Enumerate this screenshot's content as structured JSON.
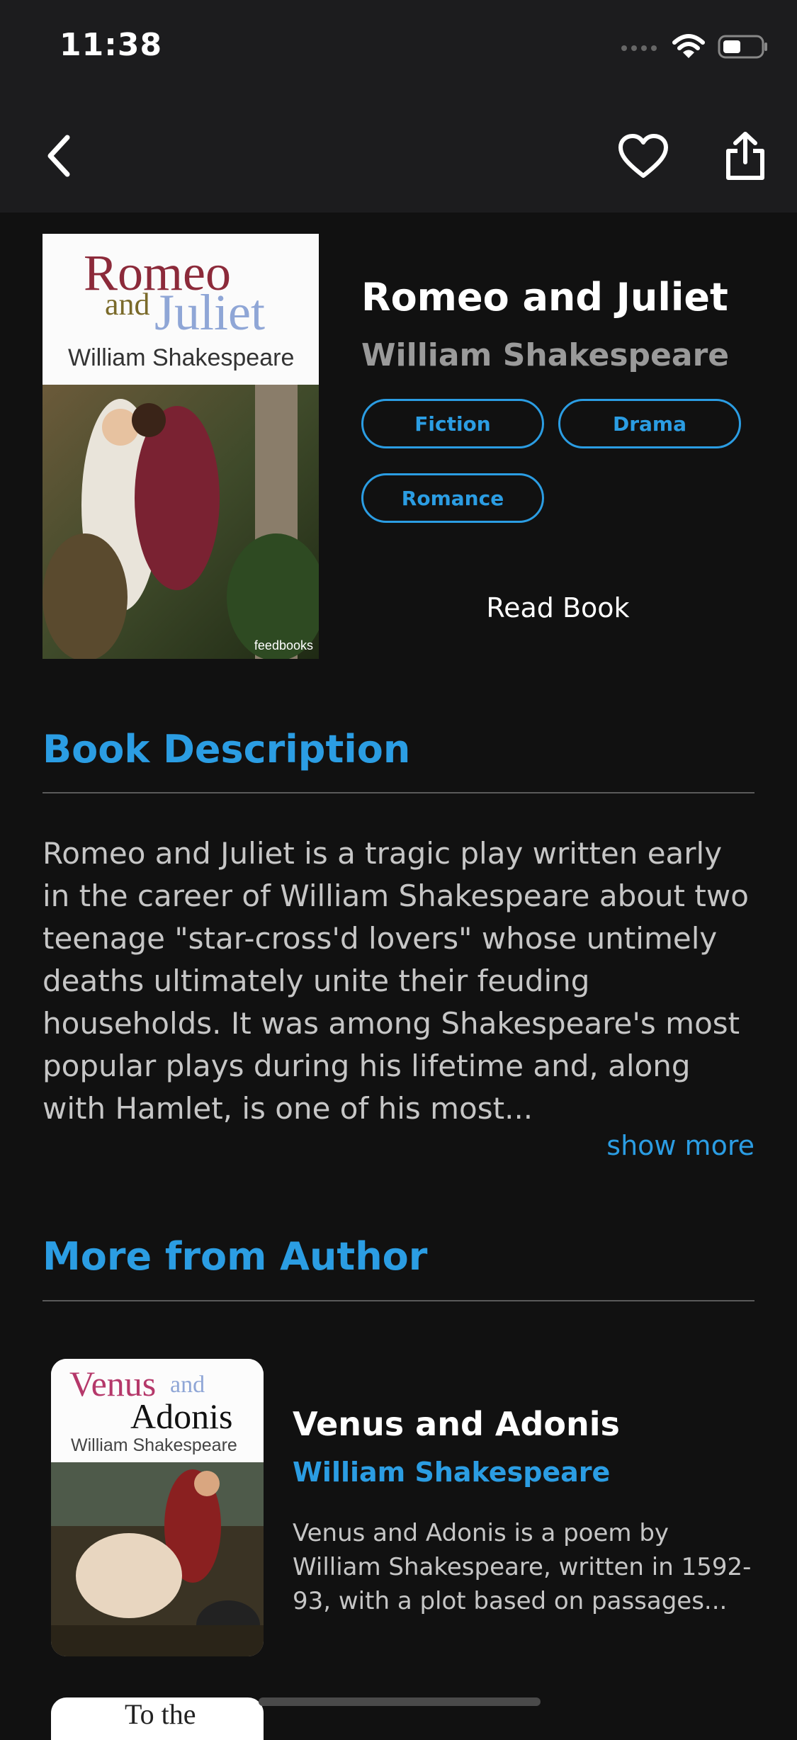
{
  "status_bar": {
    "time": "11:38",
    "signal_icon": "signal-icon",
    "wifi_icon": "wifi-icon",
    "battery_icon": "battery-icon"
  },
  "nav": {
    "back_icon": "chevron-left-icon",
    "favorite_icon": "heart-icon",
    "share_icon": "share-icon"
  },
  "book": {
    "cover": {
      "title_line1": "Romeo",
      "title_and": "and",
      "title_line2": "Juliet",
      "author": "William Shakespeare",
      "publisher": "feedbooks"
    },
    "title": "Romeo and Juliet",
    "author": "William Shakespeare",
    "tags": [
      "Fiction",
      "Drama",
      "Romance"
    ],
    "read_label": "Read Book"
  },
  "description_section": {
    "title": "Book Description",
    "text": "Romeo and Juliet is a tragic play written early in the career of William Shakespeare about two teenage \"star-cross'd lovers\" whose untimely deaths ultimately unite their feuding households. It was among Shakespeare's most popular plays during his lifetime and, along with Hamlet, is one of his most...",
    "show_more": "show more"
  },
  "more_section": {
    "title": "More from Author",
    "items": [
      {
        "cover_word1": "Venus",
        "cover_and": "and",
        "cover_word2": "Adonis",
        "cover_author": "William Shakespeare",
        "title": "Venus and Adonis",
        "author": "William Shakespeare",
        "description": "Venus and Adonis is a poem by William Shakespeare, written in 1592-93, with a plot based on passages..."
      },
      {
        "cover_partial": "To the"
      }
    ]
  },
  "colors": {
    "accent": "#2b9de3",
    "background": "#111111",
    "bar": "#1c1c1e"
  }
}
